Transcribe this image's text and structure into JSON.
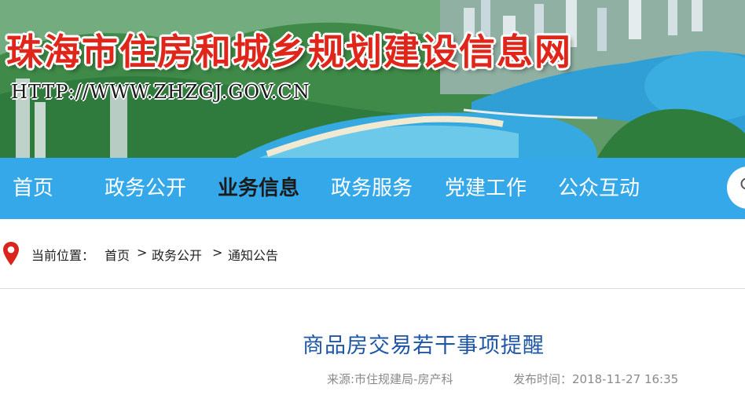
{
  "header": {
    "site_title": "珠海市住房和城乡规划建设信息网",
    "site_url": "HTTP://WWW.ZHZGJ.GOV.CN"
  },
  "nav": {
    "items": [
      {
        "label": "首页",
        "active": false
      },
      {
        "label": "政务公开",
        "active": false
      },
      {
        "label": "业务信息",
        "active": true
      },
      {
        "label": "政务服务",
        "active": false
      },
      {
        "label": "党建工作",
        "active": false
      },
      {
        "label": "公众互动",
        "active": false
      }
    ],
    "search_icon": "search-icon"
  },
  "breadcrumb": {
    "icon": "location-pin-icon",
    "prefix": "当前位置：",
    "items": [
      "首页",
      "政务公开",
      "通知公告"
    ],
    "separator": ">"
  },
  "article": {
    "title": "商品房交易若干事项提醒",
    "source": "来源:市住规建局-房产科",
    "published": "发布时间：2018-11-27 16:35"
  },
  "colors": {
    "nav_bg": "#35a8ea",
    "title_red": "#e0251b",
    "article_title_blue": "#1f56a6",
    "pin_red": "#d9261c"
  }
}
